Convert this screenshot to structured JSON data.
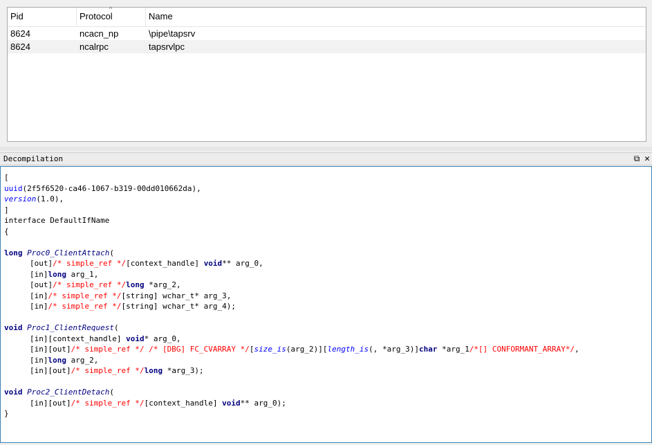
{
  "endpoints": {
    "columns": [
      "Pid",
      "Protocol",
      "Name"
    ],
    "rows": [
      {
        "pid": "8624",
        "protocol": "ncacn_np",
        "name": "\\pipe\\tapsrv"
      },
      {
        "pid": "8624",
        "protocol": "ncalrpc",
        "name": "tapsrvlpc"
      }
    ]
  },
  "decompilation": {
    "title": "Decompilation",
    "restore_icon": "⧉",
    "close_icon": "✕",
    "lines": [
      {
        "indent": false,
        "parts": [
          {
            "t": "["
          }
        ]
      },
      {
        "indent": false,
        "parts": [
          {
            "t": "uuid",
            "c": "fn"
          },
          {
            "t": "(2f5f6520-ca46-1067-b319-00dd010662da),"
          }
        ]
      },
      {
        "indent": false,
        "parts": [
          {
            "t": "version",
            "c": "it"
          },
          {
            "t": "(1.0),"
          }
        ]
      },
      {
        "indent": false,
        "parts": [
          {
            "t": "]"
          }
        ]
      },
      {
        "indent": false,
        "parts": [
          {
            "t": "interface DefaultIfName"
          }
        ]
      },
      {
        "indent": false,
        "parts": [
          {
            "t": "{"
          }
        ]
      },
      {
        "indent": false,
        "parts": [
          {
            "t": ""
          }
        ]
      },
      {
        "indent": false,
        "parts": [
          {
            "t": "long",
            "c": "kw"
          },
          {
            "t": " "
          },
          {
            "t": "Proc0_ClientAttach",
            "c": "pn"
          },
          {
            "t": "("
          }
        ]
      },
      {
        "indent": true,
        "parts": [
          {
            "t": "[out]"
          },
          {
            "t": "/* simple_ref */",
            "c": "cm"
          },
          {
            "t": "[context_handle] "
          },
          {
            "t": "void",
            "c": "kw"
          },
          {
            "t": "** arg_0,"
          }
        ]
      },
      {
        "indent": true,
        "parts": [
          {
            "t": "[in]"
          },
          {
            "t": "long",
            "c": "kw"
          },
          {
            "t": " arg_1,"
          }
        ]
      },
      {
        "indent": true,
        "parts": [
          {
            "t": "[out]"
          },
          {
            "t": "/* simple_ref */",
            "c": "cm"
          },
          {
            "t": "long",
            "c": "kw"
          },
          {
            "t": " *arg_2,"
          }
        ]
      },
      {
        "indent": true,
        "parts": [
          {
            "t": "[in]"
          },
          {
            "t": "/* simple_ref */",
            "c": "cm"
          },
          {
            "t": "[string] wchar_t* arg_3,"
          }
        ]
      },
      {
        "indent": true,
        "parts": [
          {
            "t": "[in]"
          },
          {
            "t": "/* simple_ref */",
            "c": "cm"
          },
          {
            "t": "[string] wchar_t* arg_4);"
          }
        ]
      },
      {
        "indent": false,
        "parts": [
          {
            "t": ""
          }
        ]
      },
      {
        "indent": false,
        "parts": [
          {
            "t": "void",
            "c": "kw"
          },
          {
            "t": " "
          },
          {
            "t": "Proc1_ClientRequest",
            "c": "pn"
          },
          {
            "t": "("
          }
        ]
      },
      {
        "indent": true,
        "parts": [
          {
            "t": "[in][context_handle] "
          },
          {
            "t": "void",
            "c": "kw"
          },
          {
            "t": "* arg_0,"
          }
        ]
      },
      {
        "indent": true,
        "parts": [
          {
            "t": "[in][out]"
          },
          {
            "t": "/* simple_ref */ /* [DBG] FC_CVARRAY */",
            "c": "cm"
          },
          {
            "t": "["
          },
          {
            "t": "size_is",
            "c": "it"
          },
          {
            "t": "(arg_2)]["
          },
          {
            "t": "length_is",
            "c": "it"
          },
          {
            "t": "(, *arg_3)]"
          },
          {
            "t": "char",
            "c": "kw"
          },
          {
            "t": " *arg_1"
          },
          {
            "t": "/*[] CONFORMANT_ARRAY*/",
            "c": "cm"
          },
          {
            "t": ","
          }
        ]
      },
      {
        "indent": true,
        "parts": [
          {
            "t": "[in]"
          },
          {
            "t": "long",
            "c": "kw"
          },
          {
            "t": " arg_2,"
          }
        ]
      },
      {
        "indent": true,
        "parts": [
          {
            "t": "[in][out]"
          },
          {
            "t": "/* simple_ref */",
            "c": "cm"
          },
          {
            "t": "long",
            "c": "kw"
          },
          {
            "t": " *arg_3);"
          }
        ]
      },
      {
        "indent": false,
        "parts": [
          {
            "t": ""
          }
        ]
      },
      {
        "indent": false,
        "parts": [
          {
            "t": "void",
            "c": "kw"
          },
          {
            "t": " "
          },
          {
            "t": "Proc2_ClientDetach",
            "c": "pn"
          },
          {
            "t": "("
          }
        ]
      },
      {
        "indent": true,
        "parts": [
          {
            "t": "[in][out]"
          },
          {
            "t": "/* simple_ref */",
            "c": "cm"
          },
          {
            "t": "[context_handle] "
          },
          {
            "t": "void",
            "c": "kw"
          },
          {
            "t": "** arg_0);"
          }
        ]
      },
      {
        "indent": false,
        "parts": [
          {
            "t": "}"
          }
        ]
      }
    ]
  }
}
